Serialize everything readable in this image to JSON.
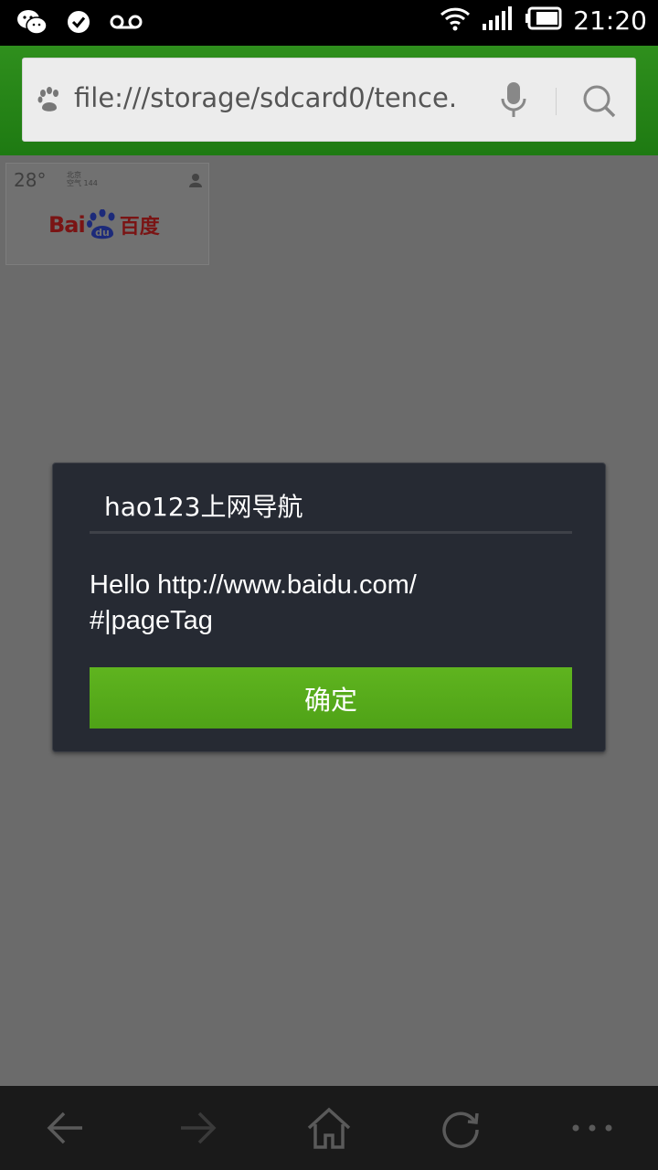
{
  "status_bar": {
    "time": "21:20",
    "left_icons": [
      "wechat-icon",
      "check-circle-icon",
      "voicemail-icon"
    ],
    "right_icons": [
      "wifi-icon",
      "signal-icon",
      "battery-icon"
    ]
  },
  "address_bar": {
    "url": "file:///storage/sdcard0/tence.",
    "icons": [
      "baidu-paw-icon",
      "microphone-icon",
      "search-icon"
    ]
  },
  "page_thumbnail": {
    "temperature": "28°",
    "city_line1": "北京",
    "city_line2": "空气 144",
    "logo_text": "Bai",
    "logo_du": "du",
    "logo_cn": "百度"
  },
  "dialog": {
    "title": "hao123上网导航",
    "message_line1": "Hello http://www.baidu.com/",
    "message_line2": "#|pageTag",
    "ok_label": "确定"
  },
  "toolbar": {
    "buttons": [
      "back-icon",
      "forward-icon",
      "home-icon",
      "refresh-icon",
      "more-icon"
    ]
  },
  "colors": {
    "header_green": "#2f8f1d",
    "button_green": "#5fb41f",
    "dialog_bg": "#262a33",
    "overlay_gray": "#6b6b6b"
  }
}
